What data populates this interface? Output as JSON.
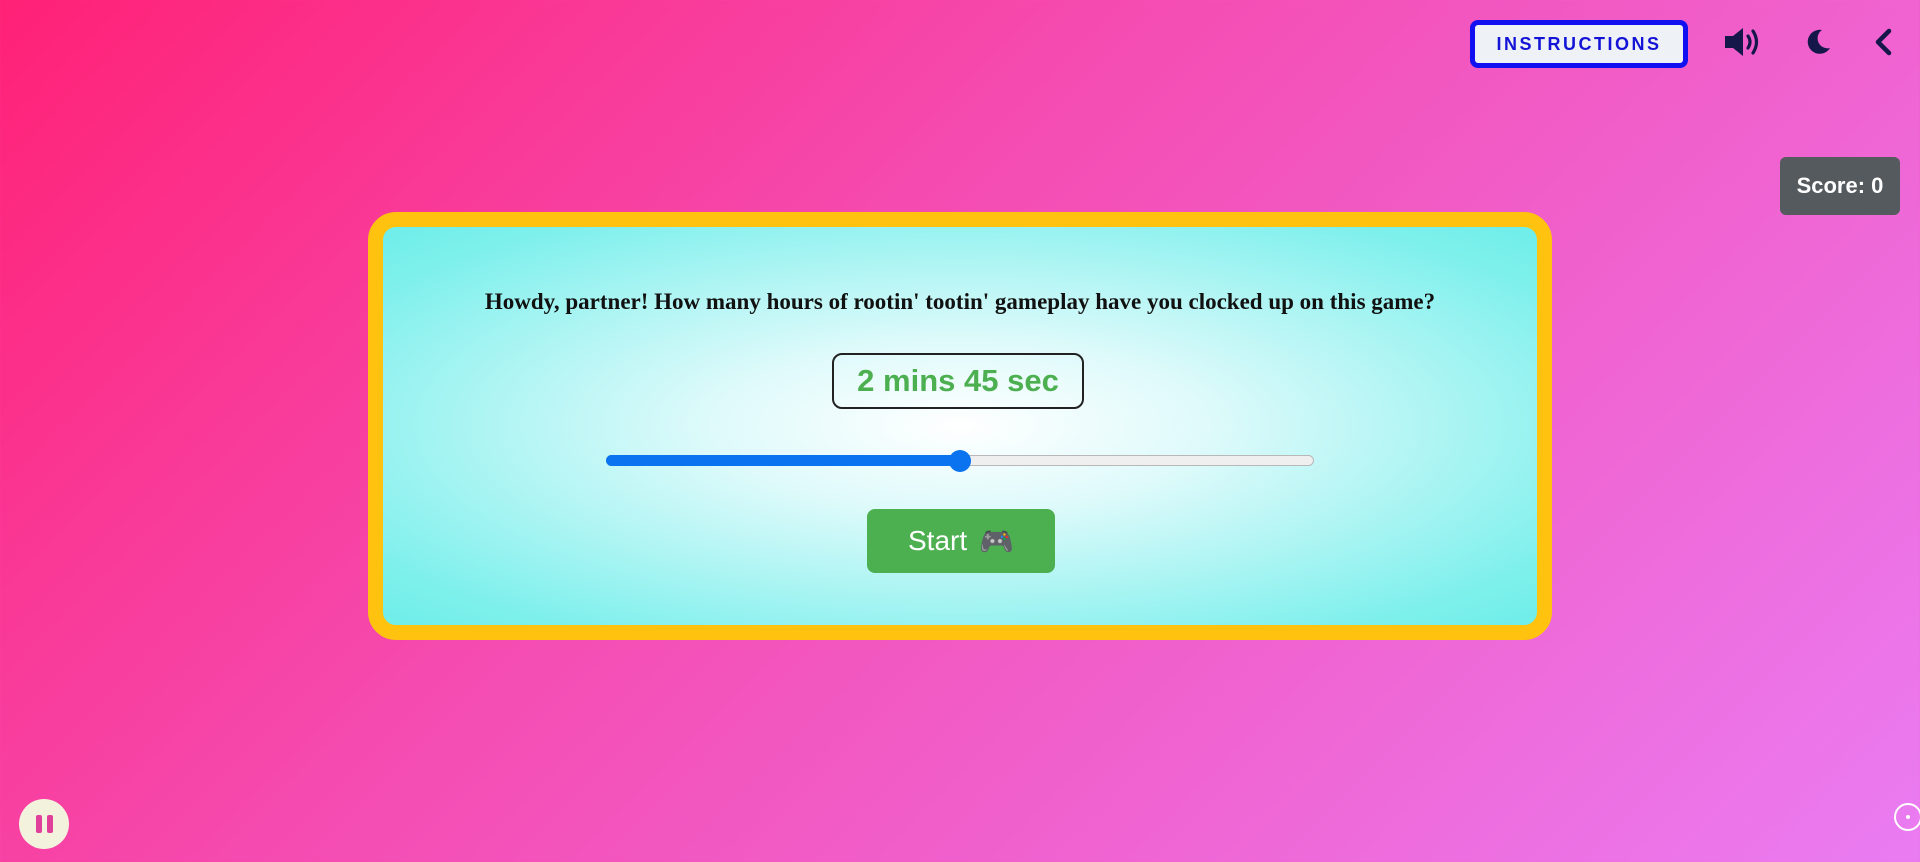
{
  "header": {
    "instructions_label": "INSTRUCTIONS",
    "icons": [
      "speaker-volume-icon",
      "moon-icon",
      "chevron-left-icon"
    ]
  },
  "score": {
    "label": "Score: 0"
  },
  "card": {
    "question": "Howdy, partner! How many hours of rootin' tootin' gameplay have you clocked up on this game?",
    "time_display": "2 mins 45 sec",
    "slider_fraction": 0.5,
    "start_label": "Start",
    "start_emoji": "🎮"
  },
  "controls": {
    "pause_icon": "pause-icon",
    "corner_icon": "circle-dot-icon"
  },
  "colors": {
    "background_start": "#ff2176",
    "background_end": "#ea7cf2",
    "card_border": "#ffc20e",
    "accent_green": "#4caf50",
    "slider_blue": "#0a74f0",
    "instructions_border": "#1010f0"
  }
}
